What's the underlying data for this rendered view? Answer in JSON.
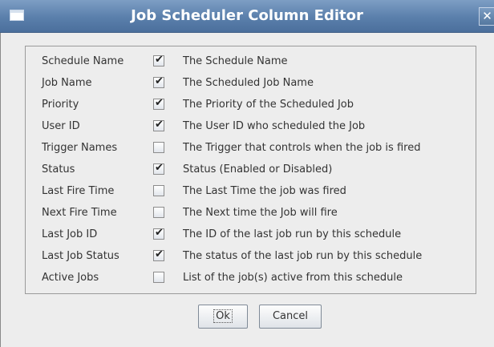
{
  "window": {
    "title": "Job Scheduler Column Editor",
    "close_label": "✕"
  },
  "columns": [
    {
      "name": "Schedule Name",
      "checked": true,
      "description": "The Schedule Name"
    },
    {
      "name": "Job Name",
      "checked": true,
      "description": "The Scheduled Job Name"
    },
    {
      "name": "Priority",
      "checked": true,
      "description": "The Priority of the Scheduled Job"
    },
    {
      "name": "User ID",
      "checked": true,
      "description": "The User ID who scheduled the Job"
    },
    {
      "name": "Trigger Names",
      "checked": false,
      "description": "The Trigger that controls when the job is fired"
    },
    {
      "name": "Status",
      "checked": true,
      "description": "Status (Enabled or Disabled)"
    },
    {
      "name": "Last Fire Time",
      "checked": false,
      "description": "The Last Time the job was fired"
    },
    {
      "name": "Next Fire Time",
      "checked": false,
      "description": "The Next time the Job will fire"
    },
    {
      "name": "Last Job ID",
      "checked": true,
      "description": "The ID of the last job run by this schedule"
    },
    {
      "name": "Last Job Status",
      "checked": true,
      "description": "The status of the last job run by this schedule"
    },
    {
      "name": "Active Jobs",
      "checked": false,
      "description": "List of the job(s) active from this schedule"
    }
  ],
  "buttons": {
    "ok_label": "Ok",
    "cancel_label": "Cancel"
  }
}
